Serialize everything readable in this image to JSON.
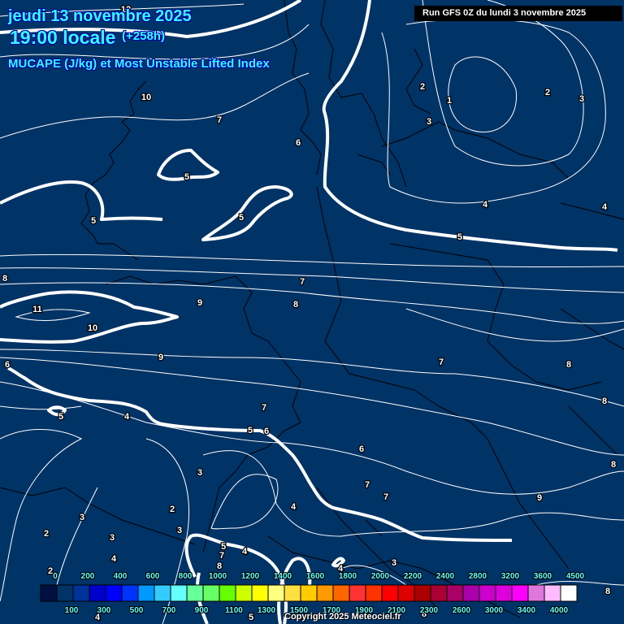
{
  "header": {
    "date": "jeudi 13 novembre 2025",
    "time": "19:00 locale",
    "lead": "(+258h)",
    "parameter": "MUCAPE (J/kg) et Most Unstable Lifted Index",
    "run": "Run GFS 0Z du lundi 3 novembre 2025"
  },
  "colors": {
    "background": "#003366",
    "contour": "#ffffff",
    "coast": "#000000",
    "title": "#33ffff"
  },
  "colorbar": {
    "unit": "J/kg",
    "colors": [
      "#001040",
      "#003366",
      "#003399",
      "#0000cc",
      "#0000ff",
      "#0033ff",
      "#0099ff",
      "#33ccff",
      "#66ffff",
      "#66ff99",
      "#66ff66",
      "#66ff00",
      "#ccff00",
      "#ffff00",
      "#ffff80",
      "#ffe040",
      "#ffcc00",
      "#ff9900",
      "#ff6600",
      "#ff3333",
      "#ff3300",
      "#ff0000",
      "#dd0000",
      "#aa0000",
      "#aa0033",
      "#aa0066",
      "#aa00aa",
      "#cc00cc",
      "#dd00dd",
      "#ff00ff",
      "#dd77dd",
      "#ffbbff",
      "#ffffff"
    ],
    "labels": [
      "0",
      "100",
      "200",
      "300",
      "400",
      "500",
      "600",
      "700",
      "800",
      "900",
      "1000",
      "1100",
      "1200",
      "1300",
      "1400",
      "1500",
      "1600",
      "1700",
      "1800",
      "1900",
      "2000",
      "2100",
      "2200",
      "2300",
      "2400",
      "2600",
      "2800",
      "3000",
      "3200",
      "3400",
      "3600",
      "4000",
      "4500"
    ]
  },
  "contour_labels": [
    "12",
    "10",
    "7",
    "6",
    "5",
    "5",
    "5",
    "2",
    "1",
    "3",
    "2",
    "3",
    "4",
    "4",
    "5",
    "8",
    "7",
    "9",
    "8",
    "11",
    "10",
    "9",
    "6",
    "7",
    "8",
    "8",
    "7",
    "5",
    "4",
    "5",
    "6",
    "6",
    "3",
    "8",
    "7",
    "7",
    "9",
    "4",
    "2",
    "3",
    "2",
    "3",
    "3",
    "5",
    "4",
    "7",
    "4",
    "8",
    "3",
    "4",
    "2",
    "8",
    "4",
    "5",
    "8"
  ],
  "copyright": "Copyright 2025 Meteociel.fr"
}
